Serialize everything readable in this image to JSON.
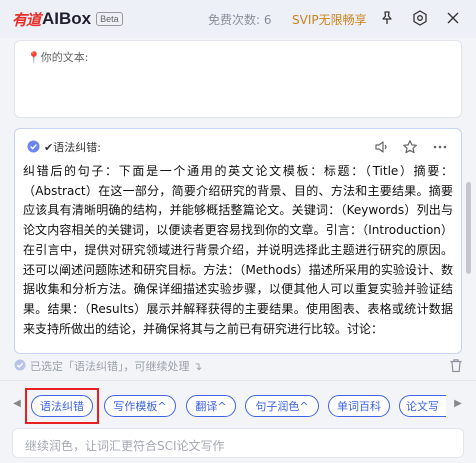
{
  "header": {
    "logo_cn": "有道",
    "logo_en": "AIBox",
    "beta": "Beta",
    "free_count": "免费次数: 6",
    "svip": "SVIP无限畅享"
  },
  "input": {
    "placeholder": "📍你的文本:"
  },
  "result": {
    "title": "✔语法纠错:",
    "body": "纠错后的句子：下面是一个通用的英文论文模板：标题：（Title）摘要：（Abstract）在这一部分，简要介绍研究的背景、目的、方法和主要结果。摘要应该具有清晰明确的结构，并能够概括整篇论文。关键词：（Keywords）列出与论文内容相关的关键词，以便读者更容易找到你的文章。引言：（Introduction）在引言中，提供对研究领域进行背景介绍，并说明选择此主题进行研究的原因。还可以阐述问题陈述和研究目标。方法：（Methods）描述所采用的实验设计、数据收集和分析方法。确保详细描述实验步骤，以便其他人可以重复实验并验证结果。结果：（Results）展示并解释获得的主要结果。使用图表、表格或统计数据来支持所做出的结论，并确保将其与之前已有研究进行比较。讨论："
  },
  "selected_hint": "已选定「语法纠错」，可继续处理 ↴",
  "chips": [
    "语法纠错",
    "写作模板^",
    "翻译^",
    "句子润色^",
    "单词百科",
    "论文写"
  ],
  "bottom_input": {
    "placeholder": "继续润色，让词汇更符合SCI论文写作"
  },
  "colors": {
    "accent": "#3f64e8",
    "brand_red": "#e8302a",
    "svip_gold": "#c9831d",
    "highlight_red": "#e82020"
  }
}
